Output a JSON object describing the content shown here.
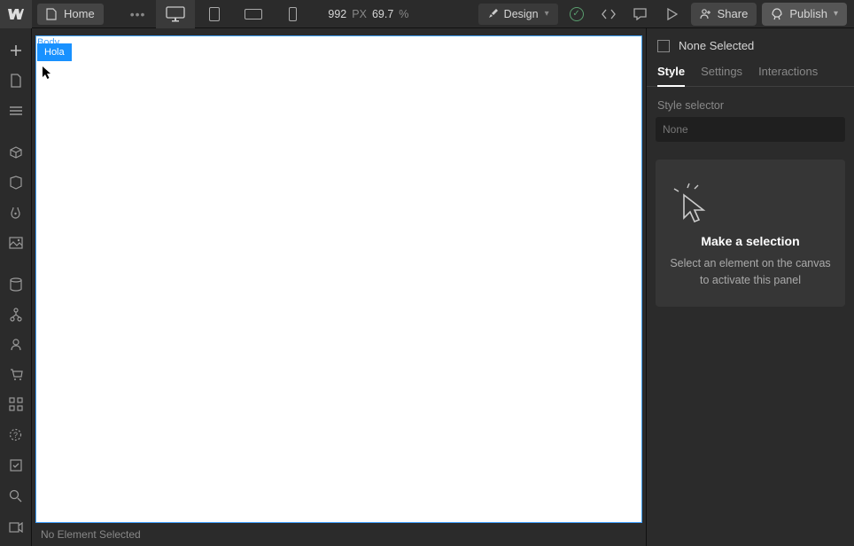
{
  "topbar": {
    "home_label": "Home",
    "canvas_width": "992",
    "px_label": "PX",
    "zoom": "69.7",
    "pct": "%",
    "mode_label": "Design",
    "share_label": "Share",
    "publish_label": "Publish"
  },
  "canvas": {
    "body_label": "Body",
    "element_text": "Hola"
  },
  "status": {
    "line": "No Element Selected"
  },
  "rightpanel": {
    "head": "None Selected",
    "tabs": {
      "style": "Style",
      "settings": "Settings",
      "interactions": "Interactions"
    },
    "selector_label": "Style selector",
    "selector_value": "None",
    "placeholder": {
      "title": "Make a selection",
      "desc": "Select an element on the canvas to activate this panel"
    }
  }
}
